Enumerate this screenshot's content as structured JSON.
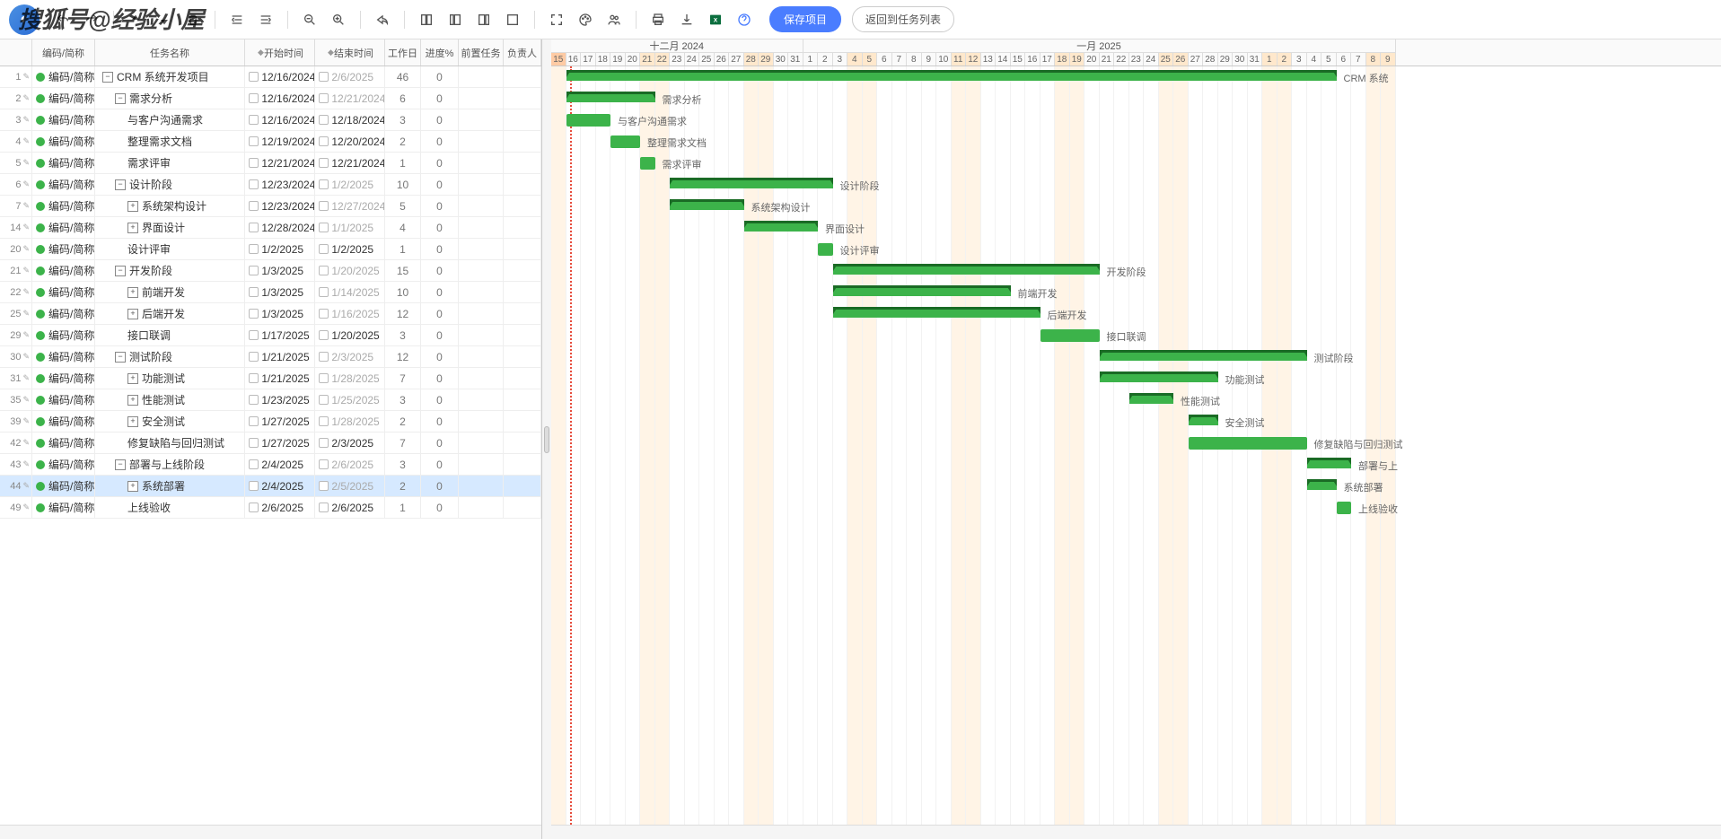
{
  "watermark": "搜狐号@经验小屋",
  "toolbar": {
    "save_label": "保存项目",
    "back_label": "返回到任务列表"
  },
  "columns": {
    "idx": "",
    "code": "编码/简称",
    "name": "任务名称",
    "start": "开始时间",
    "end": "结束时间",
    "workdays": "工作日",
    "progress": "进度%",
    "pred": "前置任务",
    "owner": "负责人"
  },
  "timeline": {
    "month1": "十二月 2024",
    "month2": "一月 2025",
    "start_date": "2024-12-15",
    "days": [
      {
        "d": "15",
        "wk": true,
        "today": true
      },
      {
        "d": "16"
      },
      {
        "d": "17"
      },
      {
        "d": "18"
      },
      {
        "d": "19"
      },
      {
        "d": "20"
      },
      {
        "d": "21",
        "wk": true
      },
      {
        "d": "22",
        "wk": true
      },
      {
        "d": "23"
      },
      {
        "d": "24"
      },
      {
        "d": "25"
      },
      {
        "d": "26"
      },
      {
        "d": "27"
      },
      {
        "d": "28",
        "wk": true
      },
      {
        "d": "29",
        "wk": true
      },
      {
        "d": "30"
      },
      {
        "d": "31"
      },
      {
        "d": "1"
      },
      {
        "d": "2"
      },
      {
        "d": "3"
      },
      {
        "d": "4",
        "wk": true
      },
      {
        "d": "5",
        "wk": true
      },
      {
        "d": "6"
      },
      {
        "d": "7"
      },
      {
        "d": "8"
      },
      {
        "d": "9"
      },
      {
        "d": "10"
      },
      {
        "d": "11",
        "wk": true
      },
      {
        "d": "12",
        "wk": true
      },
      {
        "d": "13"
      },
      {
        "d": "14"
      },
      {
        "d": "15"
      },
      {
        "d": "16"
      },
      {
        "d": "17"
      },
      {
        "d": "18",
        "wk": true
      },
      {
        "d": "19",
        "wk": true
      },
      {
        "d": "20"
      },
      {
        "d": "21"
      },
      {
        "d": "22"
      },
      {
        "d": "23"
      },
      {
        "d": "24"
      },
      {
        "d": "25",
        "wk": true
      },
      {
        "d": "26",
        "wk": true
      },
      {
        "d": "27"
      },
      {
        "d": "28"
      },
      {
        "d": "29"
      },
      {
        "d": "30"
      },
      {
        "d": "31"
      },
      {
        "d": "1",
        "wk": true
      },
      {
        "d": "2",
        "wk": true
      },
      {
        "d": "3"
      },
      {
        "d": "4"
      },
      {
        "d": "5"
      },
      {
        "d": "6"
      },
      {
        "d": "7"
      },
      {
        "d": "8",
        "wk": true
      },
      {
        "d": "9",
        "wk": true
      }
    ]
  },
  "tasks": [
    {
      "idx": 1,
      "code": "编码/简称",
      "name": "CRM 系统开发项目",
      "level": 0,
      "tg": "-",
      "start": "12/16/2024",
      "end": "2/6/2025",
      "end_gray": true,
      "wd": "46",
      "wd_gray": true,
      "prog": "0",
      "bar_s": 1,
      "bar_e": 53,
      "summary": true,
      "label": "CRM 系统"
    },
    {
      "idx": 2,
      "code": "编码/简称",
      "name": "需求分析",
      "level": 1,
      "tg": "-",
      "start": "12/16/2024",
      "end": "12/21/2024",
      "end_gray": true,
      "wd": "6",
      "wd_gray": true,
      "prog": "0",
      "bar_s": 1,
      "bar_e": 7,
      "summary": true,
      "label": "需求分析"
    },
    {
      "idx": 3,
      "code": "编码/简称",
      "name": "与客户沟通需求",
      "level": 2,
      "start": "12/16/2024",
      "end": "12/18/2024",
      "wd": "3",
      "prog": "0",
      "bar_s": 1,
      "bar_e": 4,
      "label": "与客户沟通需求"
    },
    {
      "idx": 4,
      "code": "编码/简称",
      "name": "整理需求文档",
      "level": 2,
      "start": "12/19/2024",
      "end": "12/20/2024",
      "wd": "2",
      "prog": "0",
      "bar_s": 4,
      "bar_e": 6,
      "label": "整理需求文档"
    },
    {
      "idx": 5,
      "code": "编码/简称",
      "name": "需求评审",
      "level": 2,
      "start": "12/21/2024",
      "end": "12/21/2024",
      "wd": "1",
      "prog": "0",
      "bar_s": 6,
      "bar_e": 7,
      "label": "需求评审"
    },
    {
      "idx": 6,
      "code": "编码/简称",
      "name": "设计阶段",
      "level": 1,
      "tg": "-",
      "start": "12/23/2024",
      "end": "1/2/2025",
      "end_gray": true,
      "wd": "10",
      "wd_gray": true,
      "prog": "0",
      "bar_s": 8,
      "bar_e": 19,
      "summary": true,
      "label": "设计阶段"
    },
    {
      "idx": 7,
      "code": "编码/简称",
      "name": "系统架构设计",
      "level": 2,
      "tg": "+",
      "start": "12/23/2024",
      "end": "12/27/2024",
      "end_gray": true,
      "wd": "5",
      "wd_gray": true,
      "prog": "0",
      "bar_s": 8,
      "bar_e": 13,
      "summary": true,
      "label": "系统架构设计"
    },
    {
      "idx": 14,
      "code": "编码/简称",
      "name": "界面设计",
      "level": 2,
      "tg": "+",
      "start": "12/28/2024",
      "end": "1/1/2025",
      "end_gray": true,
      "wd": "4",
      "wd_gray": true,
      "prog": "0",
      "bar_s": 13,
      "bar_e": 18,
      "summary": true,
      "label": "界面设计"
    },
    {
      "idx": 20,
      "code": "编码/简称",
      "name": "设计评审",
      "level": 2,
      "start": "1/2/2025",
      "end": "1/2/2025",
      "wd": "1",
      "prog": "0",
      "bar_s": 18,
      "bar_e": 19,
      "label": "设计评审"
    },
    {
      "idx": 21,
      "code": "编码/简称",
      "name": "开发阶段",
      "level": 1,
      "tg": "-",
      "start": "1/3/2025",
      "end": "1/20/2025",
      "end_gray": true,
      "wd": "15",
      "wd_gray": true,
      "prog": "0",
      "bar_s": 19,
      "bar_e": 37,
      "summary": true,
      "label": "开发阶段"
    },
    {
      "idx": 22,
      "code": "编码/简称",
      "name": "前端开发",
      "level": 2,
      "tg": "+",
      "start": "1/3/2025",
      "end": "1/14/2025",
      "end_gray": true,
      "wd": "10",
      "wd_gray": true,
      "prog": "0",
      "bar_s": 19,
      "bar_e": 31,
      "summary": true,
      "label": "前端开发"
    },
    {
      "idx": 25,
      "code": "编码/简称",
      "name": "后端开发",
      "level": 2,
      "tg": "+",
      "start": "1/3/2025",
      "end": "1/16/2025",
      "end_gray": true,
      "wd": "12",
      "wd_gray": true,
      "prog": "0",
      "bar_s": 19,
      "bar_e": 33,
      "summary": true,
      "label": "后端开发"
    },
    {
      "idx": 29,
      "code": "编码/简称",
      "name": "接口联调",
      "level": 2,
      "start": "1/17/2025",
      "end": "1/20/2025",
      "wd": "3",
      "prog": "0",
      "bar_s": 33,
      "bar_e": 37,
      "label": "接口联调"
    },
    {
      "idx": 30,
      "code": "编码/简称",
      "name": "测试阶段",
      "level": 1,
      "tg": "-",
      "start": "1/21/2025",
      "end": "2/3/2025",
      "end_gray": true,
      "wd": "12",
      "wd_gray": true,
      "prog": "0",
      "bar_s": 37,
      "bar_e": 51,
      "summary": true,
      "label": "测试阶段"
    },
    {
      "idx": 31,
      "code": "编码/简称",
      "name": "功能测试",
      "level": 2,
      "tg": "+",
      "start": "1/21/2025",
      "end": "1/28/2025",
      "end_gray": true,
      "wd": "7",
      "wd_gray": true,
      "prog": "0",
      "bar_s": 37,
      "bar_e": 45,
      "summary": true,
      "label": "功能测试"
    },
    {
      "idx": 35,
      "code": "编码/简称",
      "name": "性能测试",
      "level": 2,
      "tg": "+",
      "start": "1/23/2025",
      "end": "1/25/2025",
      "end_gray": true,
      "wd": "3",
      "wd_gray": true,
      "prog": "0",
      "bar_s": 39,
      "bar_e": 42,
      "summary": true,
      "label": "性能测试"
    },
    {
      "idx": 39,
      "code": "编码/简称",
      "name": "安全测试",
      "level": 2,
      "tg": "+",
      "start": "1/27/2025",
      "end": "1/28/2025",
      "end_gray": true,
      "wd": "2",
      "wd_gray": true,
      "prog": "0",
      "bar_s": 43,
      "bar_e": 45,
      "summary": true,
      "label": "安全测试"
    },
    {
      "idx": 42,
      "code": "编码/简称",
      "name": "修复缺陷与回归测试",
      "level": 2,
      "start": "1/27/2025",
      "end": "2/3/2025",
      "wd": "7",
      "prog": "0",
      "bar_s": 43,
      "bar_e": 51,
      "label": "修复缺陷与回归测试"
    },
    {
      "idx": 43,
      "code": "编码/简称",
      "name": "部署与上线阶段",
      "level": 1,
      "tg": "-",
      "start": "2/4/2025",
      "end": "2/6/2025",
      "end_gray": true,
      "wd": "3",
      "wd_gray": true,
      "prog": "0",
      "bar_s": 51,
      "bar_e": 54,
      "summary": true,
      "label": "部署与上"
    },
    {
      "idx": 44,
      "code": "编码/简称",
      "name": "系统部署",
      "level": 2,
      "tg": "+",
      "start": "2/4/2025",
      "end": "2/5/2025",
      "end_gray": true,
      "wd": "2",
      "wd_gray": true,
      "prog": "0",
      "bar_s": 51,
      "bar_e": 53,
      "summary": true,
      "label": "系统部署",
      "selected": true
    },
    {
      "idx": 49,
      "code": "编码/简称",
      "name": "上线验收",
      "level": 2,
      "start": "2/6/2025",
      "end": "2/6/2025",
      "wd": "1",
      "prog": "0",
      "bar_s": 53,
      "bar_e": 54,
      "label": "上线验收"
    }
  ]
}
